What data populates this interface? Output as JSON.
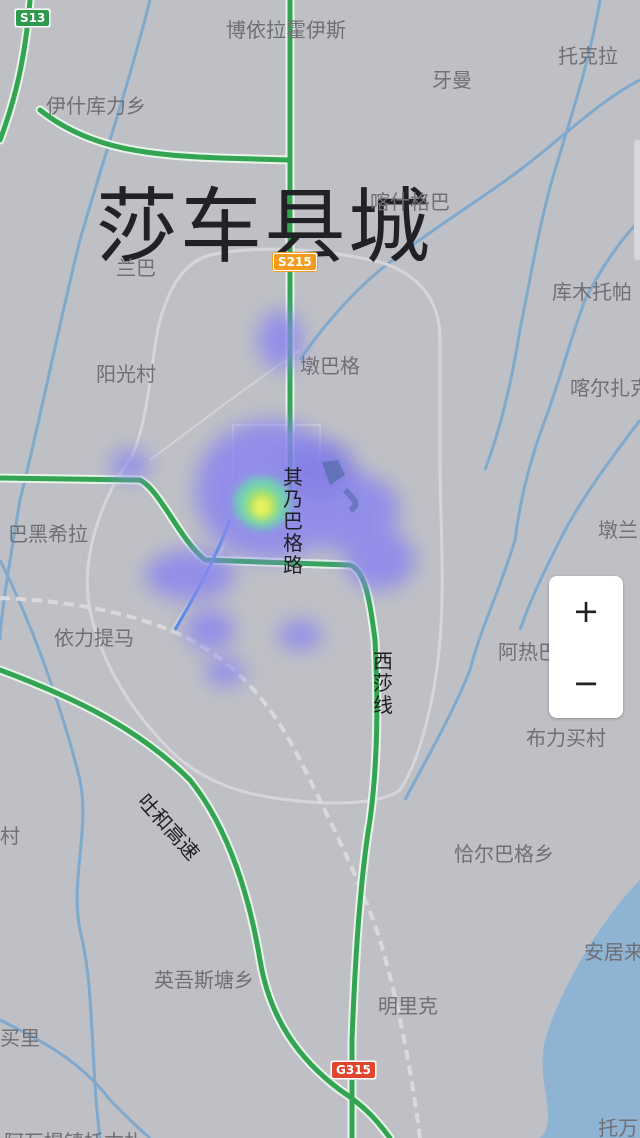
{
  "map": {
    "title": "莎车县城",
    "places": {
      "boyilahuoyisi": "博依拉霍伊斯",
      "tuokela": "托克拉",
      "yaman": "牙曼",
      "yishikulixiang": "伊什库力乡",
      "kashigeban": "喀什格巴",
      "sanba": "兰巴",
      "kumutuopa": "库木托帕",
      "yangguangcun": "阳光村",
      "dunbage": "墩巴格",
      "kaerzha": "喀尔扎克",
      "baheixila": "巴黑希拉",
      "dunlan": "墩兰",
      "yilitima": "依力提马",
      "areba": "阿热巴",
      "bulimaicun": "布力买村",
      "cun": "村",
      "qiaerbagexiang": "恰尔巴格乡",
      "anjulai": "安居来",
      "yingwusitangxiang": "英吾斯塘乡",
      "mingliko": "明里克",
      "maili": "买里",
      "tuofang": "托万",
      "bottom": "阿瓦提镇托古扎"
    },
    "roads": {
      "qinaibage": "其乃巴格路",
      "xisha": "西莎线",
      "tuhe": "吐和高速"
    },
    "shields": {
      "s13": "S13",
      "s215": "S215",
      "g315": "G315"
    }
  },
  "zoom": {
    "in_label": "+",
    "out_label": "−"
  },
  "colors": {
    "land": "#bfc0c5",
    "water": "#78a8cc",
    "highway": "#33a552",
    "heat_low": "#8b86ef",
    "heat_mid": "#60c8c0",
    "heat_high": "#e8f060"
  }
}
